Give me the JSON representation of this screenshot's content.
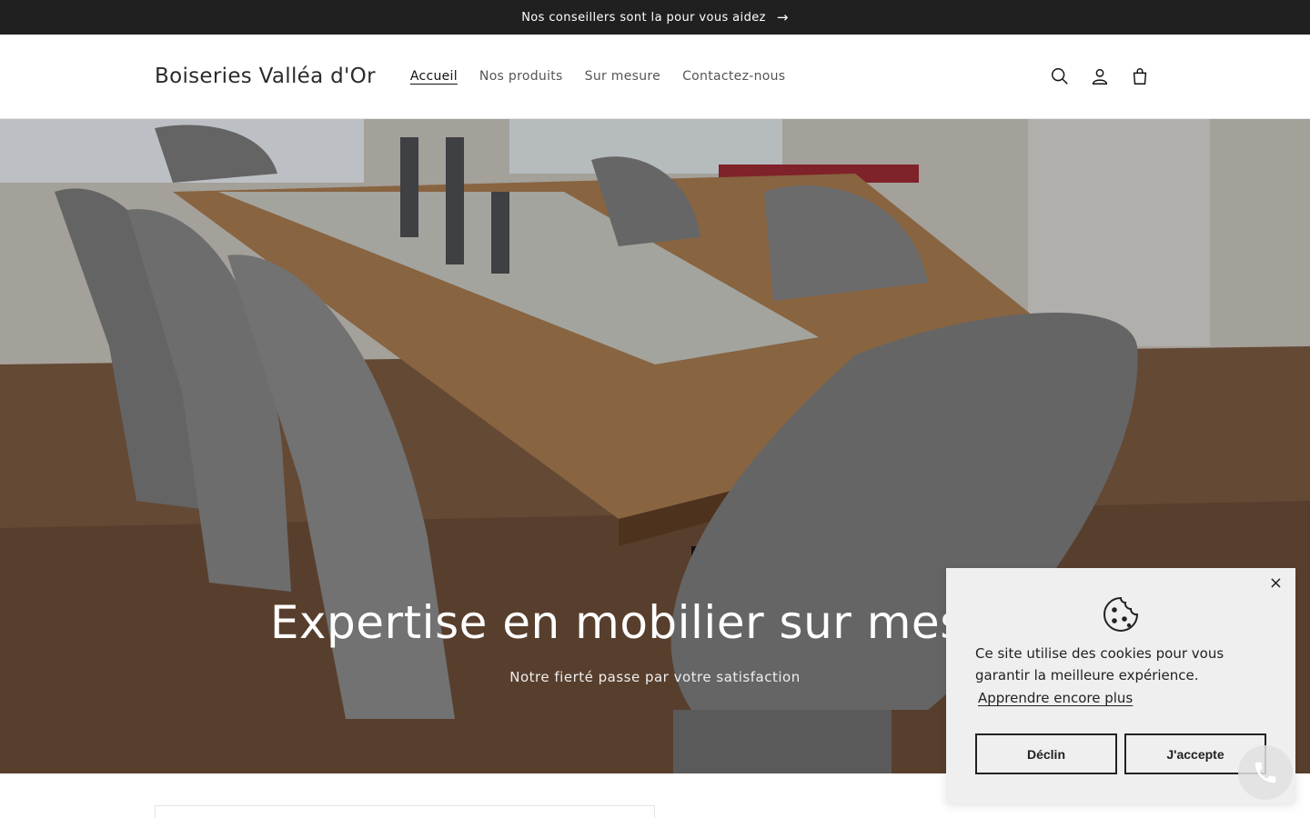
{
  "announcement": {
    "text": "Nos conseillers sont la pour vous aidez",
    "arrow": "→"
  },
  "header": {
    "logo": "Boiseries Valléa d'Or",
    "nav": [
      {
        "label": "Accueil",
        "active": true
      },
      {
        "label": "Nos produits",
        "active": false
      },
      {
        "label": "Sur mesure",
        "active": false
      },
      {
        "label": "Contactez-nous",
        "active": false
      }
    ],
    "icons": [
      "search-icon",
      "account-icon",
      "cart-icon"
    ]
  },
  "hero": {
    "title": "Expertise en mobilier sur mesure",
    "subtitle": "Notre fierté passe par votre satisfaction"
  },
  "cookie_banner": {
    "message": "Ce site utilise des cookies pour vous garantir la meilleure expérience.",
    "learn_more": "Apprendre encore plus",
    "decline": "Déclin",
    "accept": "J'accepte",
    "close": "×",
    "icon": "cookie-icon"
  },
  "phone_button": {
    "icon": "phone-icon"
  }
}
